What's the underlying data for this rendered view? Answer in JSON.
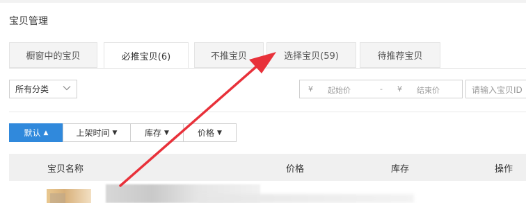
{
  "page": {
    "title": "宝贝管理"
  },
  "tabs": [
    {
      "label": "橱窗中的宝贝",
      "active": false
    },
    {
      "label": "必推宝贝(6)",
      "active": true
    },
    {
      "label": "不推宝贝",
      "active": false
    },
    {
      "label": "选择宝贝(59)",
      "active": false
    },
    {
      "label": "待推荐宝贝",
      "active": false
    }
  ],
  "filters": {
    "category": {
      "selected": "所有分类"
    },
    "price": {
      "currency": "¥",
      "min_placeholder": "起始价",
      "separator": "-",
      "max_placeholder": "结束价"
    },
    "search": {
      "placeholder": "请输入宝贝ID"
    }
  },
  "sort_buttons": [
    {
      "label": "默认",
      "active": true,
      "arrow": "up"
    },
    {
      "label": "上架时间",
      "active": false,
      "arrow": "down"
    },
    {
      "label": "库存",
      "active": false,
      "arrow": "down"
    },
    {
      "label": "价格",
      "active": false,
      "arrow": "down"
    }
  ],
  "table": {
    "columns": [
      "宝贝名称",
      "价格",
      "库存",
      "操作"
    ]
  },
  "colors": {
    "accent": "#3089dc",
    "annotation_arrow": "#e8313a"
  },
  "icons": {
    "chevron": "chevron-down-icon",
    "sort_up": "triangle-up-icon",
    "sort_down": "triangle-down-icon"
  }
}
